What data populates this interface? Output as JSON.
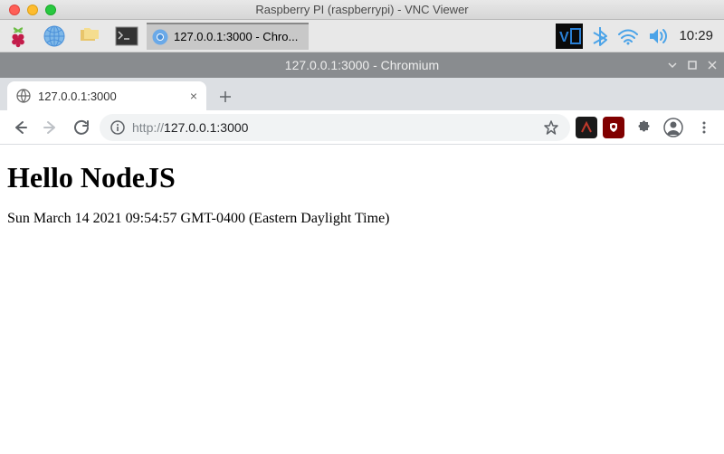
{
  "mac": {
    "title": "Raspberry PI (raspberrypi) - VNC Viewer"
  },
  "pi": {
    "task_label": "127.0.0.1:3000 - Chro...",
    "clock": "10:29"
  },
  "chromium": {
    "window_title": "127.0.0.1:3000 - Chromium",
    "tab_label": "127.0.0.1:3000",
    "url_proto": "http://",
    "url_rest": "127.0.0.1:3000"
  },
  "page": {
    "heading": "Hello NodeJS",
    "body": "Sun March 14 2021 09:54:57 GMT-0400 (Eastern Daylight Time)"
  }
}
